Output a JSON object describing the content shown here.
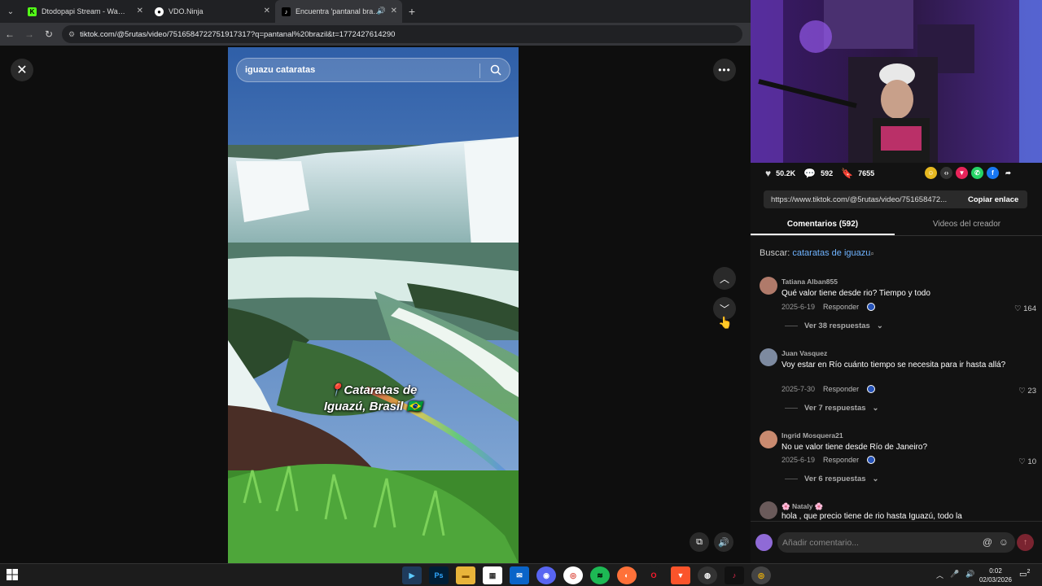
{
  "browser": {
    "tabs": [
      {
        "title": "Dtodopapi Stream - Watch Live",
        "favicon": "K",
        "color": "#53fc18",
        "active": false
      },
      {
        "title": "VDO.Ninja",
        "favicon": "V",
        "color": "#dddddd",
        "active": false
      },
      {
        "title": "Encuentra 'pantanal brazil'",
        "favicon": "♪",
        "color": "#111111",
        "active": true
      }
    ],
    "url": "tiktok.com/@5rutas/video/7516584722751917317?q=pantanal%20brazil&t=1772427614290"
  },
  "video": {
    "search_query": "iguazu cataratas",
    "caption_line1": "Cataratas de",
    "caption_line2": "Iguazú, Brasil 🇧🇷"
  },
  "panel": {
    "likes": "50.2K",
    "comments_count": "592",
    "saves": "7655",
    "link": "https://www.tiktok.com/@5rutas/video/751658472...",
    "copy_label": "Copiar enlace",
    "tab_comments": "Comentarios (592)",
    "tab_creator": "Videos del creador",
    "search_prefix": "Buscar:",
    "search_term": "cataratas de iguazu",
    "comments": [
      {
        "user": "Tatiana Alban855",
        "text": "Qué valor tiene desde rio? Tiempo y todo",
        "date": "2025-6-19",
        "reply": "Responder",
        "likes": "164",
        "more": "Ver 38 respuestas",
        "avatar": "#b07a6a"
      },
      {
        "user": "Juan Vasquez",
        "text": "Voy estar en Río cuánto tiempo se necesita para ir hasta allá?",
        "date": "2025-7-30",
        "reply": "Responder",
        "likes": "23",
        "more": "Ver 7 respuestas",
        "avatar": "#7d8aa0"
      },
      {
        "user": "Ingrid Mosquera21",
        "text": "No ue valor tiene desde Río de Janeiro?",
        "date": "2025-6-19",
        "reply": "Responder",
        "likes": "10",
        "more": "Ver 6 respuestas",
        "avatar": "#c98a6f"
      },
      {
        "user": "🌸 Nataly 🌸",
        "text": "hola , que precio tiene de rio hasta Iguazú, todo la",
        "avatar": "#6a5a5a"
      }
    ],
    "add_comment_placeholder": "Añadir comentario..."
  },
  "taskbar": {
    "time": "0:02",
    "date": "02/03/2026",
    "notifications": "2"
  },
  "icons": [
    "close-icon",
    "more-icon",
    "search-icon",
    "chevron-up-icon",
    "chevron-down-icon",
    "volume-icon",
    "heart-icon",
    "comment-icon",
    "bookmark-icon",
    "share-icon"
  ]
}
